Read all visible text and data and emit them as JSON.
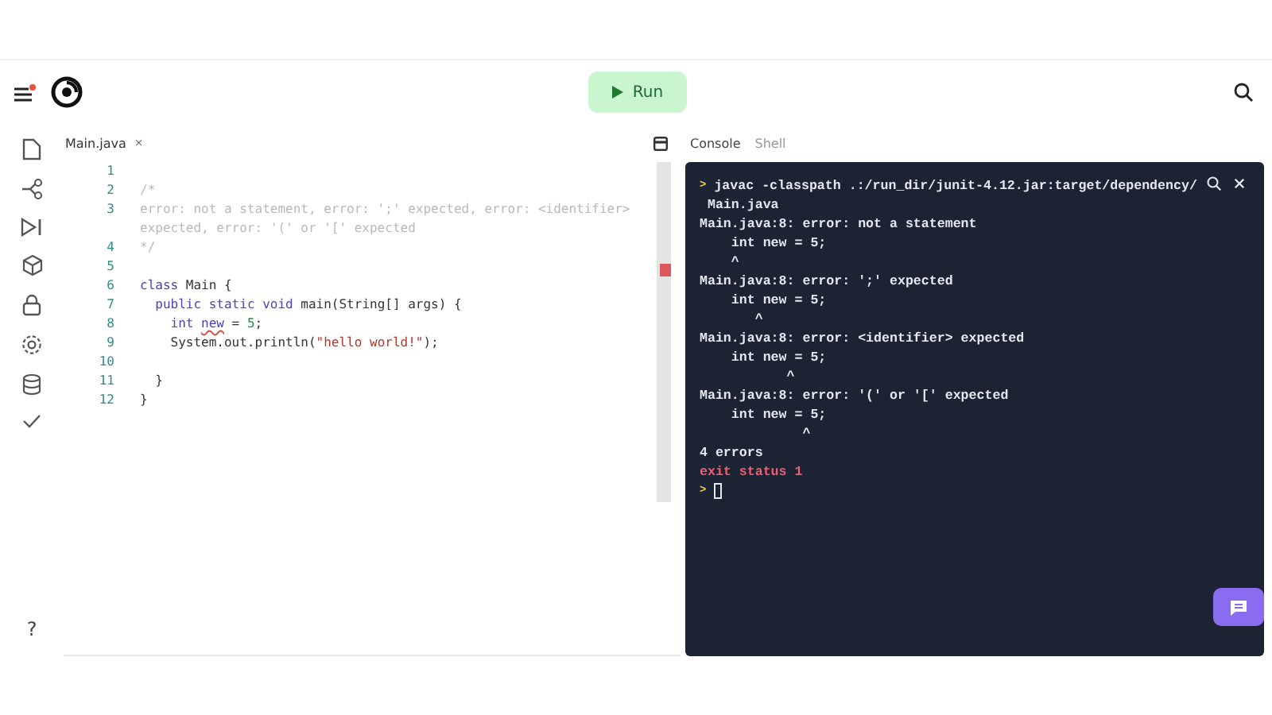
{
  "topbar": {
    "run_button": "Run"
  },
  "sidebar": {
    "help": "?"
  },
  "editor": {
    "tab": {
      "label": "Main.java",
      "close": "×"
    },
    "lines": [
      {
        "number": "1"
      },
      {
        "number": "2",
        "segments": [
          {
            "kind": "comment",
            "text": "/*"
          }
        ]
      },
      {
        "number": "3",
        "segments": [
          {
            "kind": "comment",
            "text": "error: not a statement, error: ';' expected, error: <identifier> expected, error: '(' or '[' expected"
          }
        ]
      },
      {
        "number": "4",
        "segments": [
          {
            "kind": "comment",
            "text": "*/"
          }
        ]
      },
      {
        "number": "5"
      },
      {
        "number": "6",
        "segments": [
          {
            "kind": "keyword",
            "text": "class"
          },
          {
            "kind": "plain",
            "text": " Main {"
          }
        ]
      },
      {
        "number": "7",
        "segments": [
          {
            "kind": "keyword",
            "text": "  public static void"
          },
          {
            "kind": "plain",
            "text": " main(String[] args) {"
          }
        ]
      },
      {
        "number": "8",
        "segments": [
          {
            "kind": "keyword",
            "text": "    int "
          },
          {
            "kind": "error",
            "text": "new"
          },
          {
            "kind": "plain",
            "text": " = "
          },
          {
            "kind": "number",
            "text": "5"
          },
          {
            "kind": "plain",
            "text": ";"
          }
        ]
      },
      {
        "number": "9",
        "segments": [
          {
            "kind": "plain",
            "text": "    System.out.println("
          },
          {
            "kind": "string",
            "text": "\"hello world!\""
          },
          {
            "kind": "plain",
            "text": ");"
          }
        ]
      },
      {
        "number": "10"
      },
      {
        "number": "11",
        "segments": [
          {
            "kind": "plain",
            "text": "  }"
          }
        ]
      },
      {
        "number": "12",
        "segments": [
          {
            "kind": "plain",
            "text": "}"
          }
        ]
      }
    ]
  },
  "console": {
    "tabs": [
      {
        "label": "Console",
        "selected": true
      },
      {
        "label": "Shell",
        "selected": false
      }
    ],
    "lines": [
      {
        "kind": "command",
        "prompt": ">",
        "text": "javac -classpath .:/run_dir/junit-4.12.jar:target/dependency/"
      },
      {
        "kind": "output",
        "text": " Main.java"
      },
      {
        "kind": "output",
        "text": "Main.java:8: error: not a statement"
      },
      {
        "kind": "output",
        "text": "    int new = 5;"
      },
      {
        "kind": "output",
        "text": "    ^"
      },
      {
        "kind": "output",
        "text": "Main.java:8: error: ';' expected"
      },
      {
        "kind": "output",
        "text": "    int new = 5;"
      },
      {
        "kind": "output",
        "text": "       ^"
      },
      {
        "kind": "output",
        "text": "Main.java:8: error: <identifier> expected"
      },
      {
        "kind": "output",
        "text": "    int new = 5;"
      },
      {
        "kind": "output",
        "text": "           ^"
      },
      {
        "kind": "output",
        "text": "Main.java:8: error: '(' or '[' expected"
      },
      {
        "kind": "output",
        "text": "    int new = 5;"
      },
      {
        "kind": "output",
        "text": "             ^"
      },
      {
        "kind": "output",
        "text": "4 errors"
      },
      {
        "kind": "error",
        "text": "exit status 1"
      },
      {
        "kind": "prompt",
        "prompt": ">"
      }
    ]
  }
}
